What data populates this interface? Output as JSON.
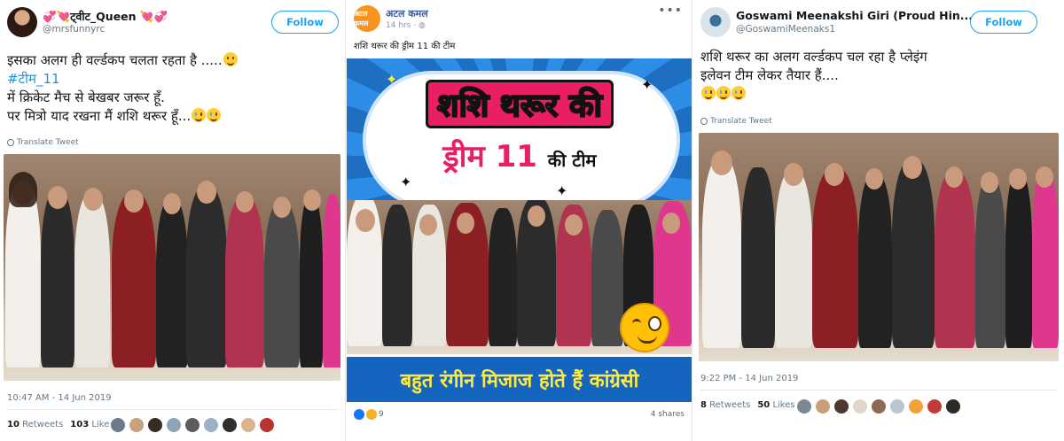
{
  "tweet1": {
    "username": "💞💘ट्वीट_Queen 💘💞",
    "handle": "@mrsfunnyrc",
    "follow_label": "Follow",
    "lines": [
      "इसका अलग ही वर्ल्डकप चलता रहता है .....",
      "#टीम_11",
      "में क्रिकेट मैच से बेखबर जरूर हूँ.",
      "पर मित्रो याद रखना मैं शशि थरूर हूँ..."
    ],
    "translate_label": "Translate Tweet",
    "timestamp": "10:47 AM - 14 Jun 2019",
    "retweets_count": "10",
    "retweets_label": "Retweets",
    "likes_count": "103",
    "likes_label": "Likes"
  },
  "fbpost": {
    "page_name": "अटल कमल",
    "avatar_text": "अटल कमल",
    "time": "14 hrs",
    "more_icon": "more-horizontal-icon",
    "caption": "शशि थरूर की ड्रीम 11 की टीम",
    "meme_title_line1": "शशि थरूर की",
    "meme_title_line2_big": "ड्रीम 11",
    "meme_title_line2_small": "की टीम",
    "meme_banner": "बहुत रंगीन मिजाज होते हैं कांग्रेसी",
    "reactions_count": "9",
    "shares": "4 shares"
  },
  "tweet3": {
    "username": "Goswami Meenakshi Giri (Proud Hin...",
    "handle": "@GoswamiMeenaks1",
    "follow_label": "Follow",
    "lines": [
      "शशि थरूर का अलग वर्ल्डकप चल रहा है  प्लेइंग",
      "इलेवन टीम लेकर तैयार हैं...."
    ],
    "translate_label": "Translate Tweet",
    "timestamp": "9:22 PM - 14 Jun 2019",
    "retweets_count": "8",
    "retweets_label": "Retweets",
    "likes_count": "50",
    "likes_label": "Likes"
  },
  "colors": {
    "twitter_blue": "#1da1f2",
    "fb_blue": "#385898",
    "meme_pink": "#e91e63",
    "meme_yellow": "#ffeb3b"
  }
}
